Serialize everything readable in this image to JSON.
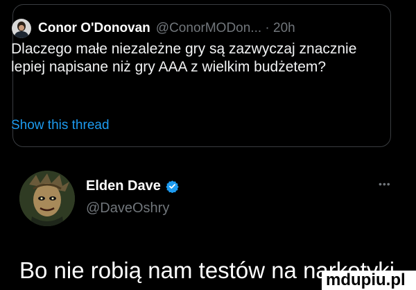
{
  "quoted_tweet": {
    "author_name": "Conor O'Donovan",
    "handle_time": "@ConorMODon... · 20h",
    "text": "Dlaczego małe niezależne gry są zazwyczaj znacznie lepiej napisane niż gry AAA z wielkim budżetem?",
    "show_thread_label": "Show this thread",
    "colors": {
      "link": "#1d9bf0",
      "muted": "#71767b"
    }
  },
  "tweet": {
    "author_name": "Elden Dave",
    "handle": "@DaveOshry",
    "text": "Bo nie robią nam testów na narkotyki",
    "more_icon": "more-dots-icon",
    "verified_icon": "verified-badge-icon"
  },
  "watermark": {
    "text": "mdupiu.pl"
  }
}
